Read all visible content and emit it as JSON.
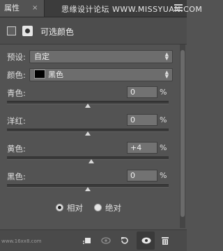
{
  "panel": {
    "tab_label": "属性",
    "tab_close": "×",
    "watermark": "思缘设计论坛 WWW.MISSYUAN.COM",
    "header_title": "可选颜色"
  },
  "controls": {
    "preset_label": "预设:",
    "preset_value": "自定",
    "colors_label": "颜色:",
    "colors_value": "黑色",
    "colors_swatch": "#000000"
  },
  "sliders": [
    {
      "label": "青色:",
      "value": "0",
      "unit": "%",
      "level": 0
    },
    {
      "label": "洋红:",
      "value": "0",
      "unit": "%",
      "level": 0
    },
    {
      "label": "黄色:",
      "value": "+4",
      "unit": "%",
      "level": 4
    },
    {
      "label": "黑色:",
      "value": "0",
      "unit": "%",
      "level": 0
    }
  ],
  "method": {
    "relative_label": "相对",
    "absolute_label": "绝对",
    "selected": "relative"
  },
  "bottom_bar": {
    "icons": [
      "clip-to-layer-icon",
      "view-previous-icon",
      "reset-icon",
      "visibility-icon",
      "trash-icon"
    ]
  },
  "footer": {
    "site_tag": "www.16xx8.com"
  },
  "icons": {
    "panel_menu": "menu-icon",
    "header_icon_1": "adjustment-icon",
    "header_icon_2": "mask-icon"
  }
}
